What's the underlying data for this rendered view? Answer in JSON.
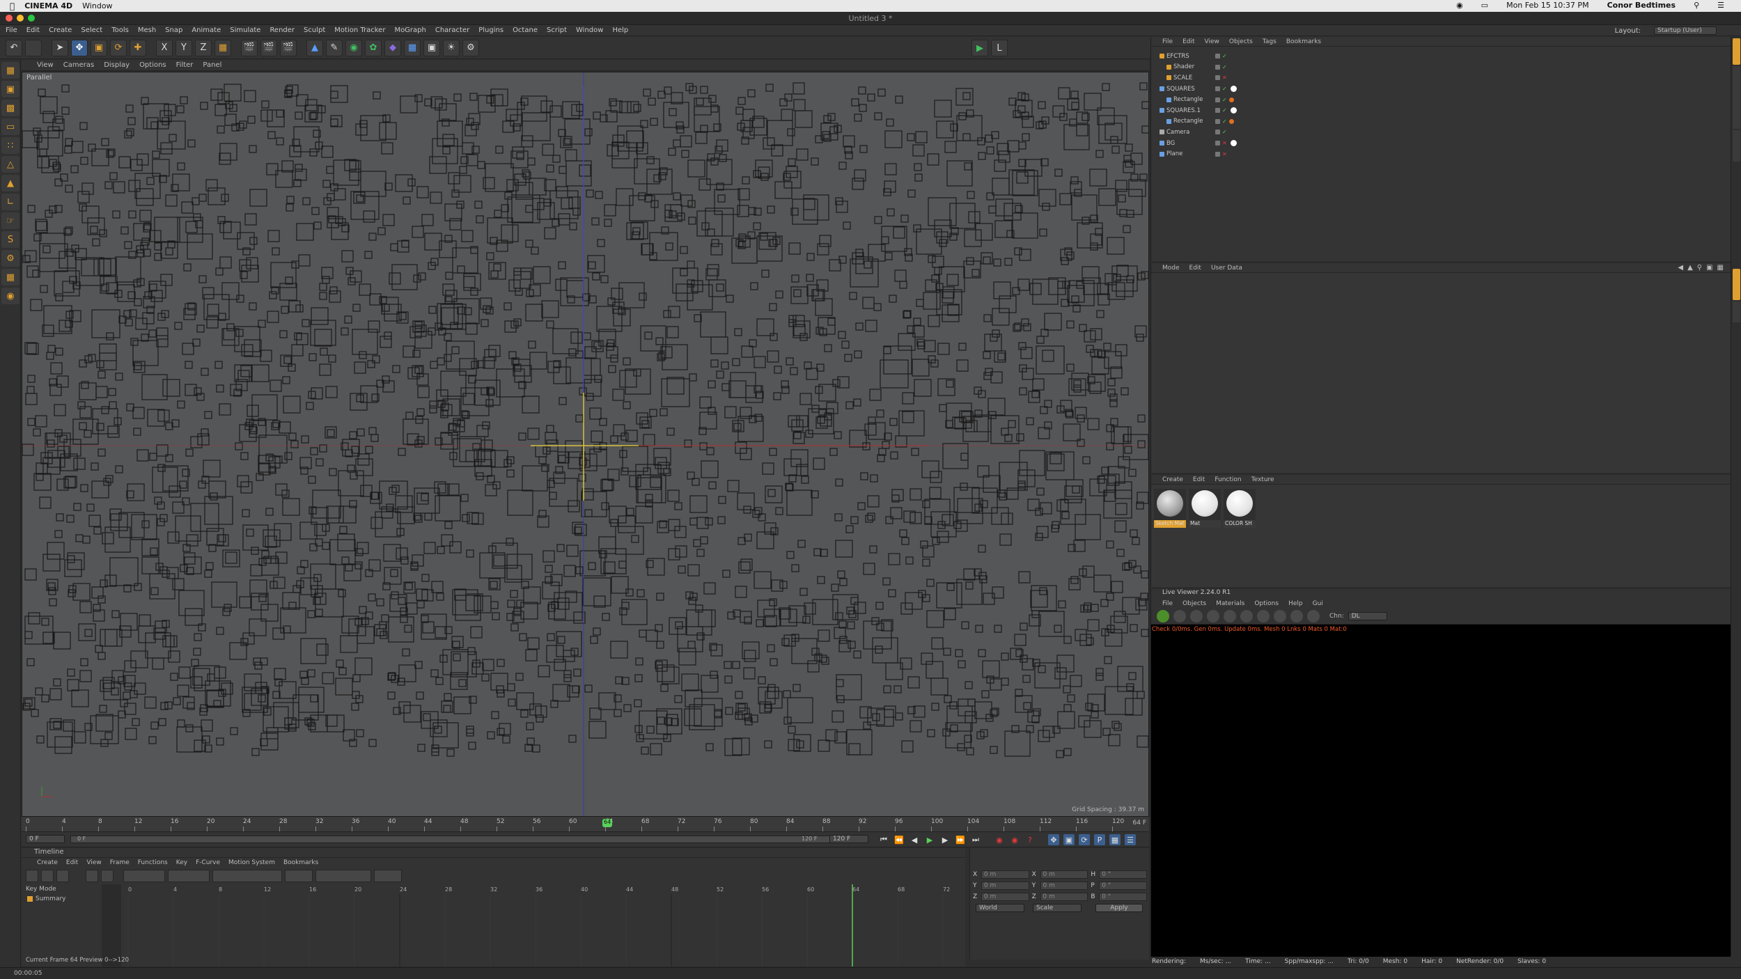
{
  "mac_menu": {
    "app": "CINEMA 4D",
    "window": "Window",
    "datetime": "Mon Feb 15  10:37 PM",
    "user": "Conor Bedtimes"
  },
  "window_title": "Untitled 3 *",
  "app_menu": [
    "File",
    "Edit",
    "Create",
    "Select",
    "Tools",
    "Mesh",
    "Snap",
    "Animate",
    "Simulate",
    "Render",
    "Sculpt",
    "Motion Tracker",
    "MoGraph",
    "Character",
    "Plugins",
    "Octane",
    "Script",
    "Window",
    "Help"
  ],
  "layout": {
    "label": "Layout:",
    "value": "Startup (User)"
  },
  "viewport": {
    "menu": [
      "View",
      "Cameras",
      "Display",
      "Options",
      "Filter",
      "Panel"
    ],
    "projection": "Parallel",
    "grid_spacing": "Grid Spacing : 39.37 m"
  },
  "timeline_ruler": {
    "ticks": [
      "0",
      "4",
      "8",
      "12",
      "16",
      "20",
      "24",
      "28",
      "32",
      "36",
      "40",
      "44",
      "48",
      "52",
      "56",
      "60",
      "64",
      "68",
      "72",
      "76",
      "80",
      "84",
      "88",
      "92",
      "96",
      "100",
      "104",
      "108",
      "112",
      "116",
      "120"
    ],
    "current_marker": "64",
    "end_field": "64 F"
  },
  "frame_controls": {
    "start": "0 F",
    "min_field": "0 F",
    "max_field": "120 F",
    "end": "120 F"
  },
  "timeline": {
    "title": "Timeline",
    "menu": [
      "Create",
      "Edit",
      "View",
      "Frame",
      "Functions",
      "Key",
      "F-Curve",
      "Motion System",
      "Bookmarks"
    ],
    "key_mode": "Key Mode",
    "summary": "Summary",
    "ruler": [
      "0",
      "4",
      "8",
      "12",
      "16",
      "20",
      "24",
      "28",
      "32",
      "36",
      "40",
      "44",
      "48",
      "52",
      "56",
      "60",
      "64",
      "68",
      "72"
    ],
    "current_frame_text": "Current Frame  64  Preview  0-->120"
  },
  "coords": {
    "rows": [
      [
        "X",
        "0 m",
        "X",
        "0 m",
        "H",
        "0 °"
      ],
      [
        "Y",
        "0 m",
        "Y",
        "0 m",
        "P",
        "0 °"
      ],
      [
        "Z",
        "0 m",
        "Z",
        "0 m",
        "B",
        "0 °"
      ]
    ],
    "mode1": "World",
    "mode2": "Scale",
    "apply": "Apply"
  },
  "object_manager": {
    "menu": [
      "File",
      "Edit",
      "View",
      "Objects",
      "Tags",
      "Bookmarks"
    ],
    "objects": [
      {
        "name": "EFCTRS",
        "indent": 0
      },
      {
        "name": "Shader",
        "indent": 1
      },
      {
        "name": "SCALE",
        "indent": 1
      },
      {
        "name": "SQUARES",
        "indent": 0
      },
      {
        "name": "Rectangle",
        "indent": 1
      },
      {
        "name": "SQUARES.1",
        "indent": 0
      },
      {
        "name": "Rectangle",
        "indent": 1
      },
      {
        "name": "Camera",
        "indent": 0
      },
      {
        "name": "BG",
        "indent": 0
      },
      {
        "name": "Plane",
        "indent": 0
      }
    ]
  },
  "attribute_manager": {
    "menu": [
      "Mode",
      "Edit",
      "User Data"
    ]
  },
  "material_manager": {
    "menu": [
      "Create",
      "Edit",
      "Function",
      "Texture"
    ],
    "materials": [
      "Sketch Mat",
      "Mat",
      "COLOR SH"
    ]
  },
  "live_viewer": {
    "title": "Live Viewer 2.24.0 R1",
    "menu": [
      "File",
      "Objects",
      "Materials",
      "Options",
      "Help",
      "Gui"
    ],
    "channel_label": "Chn:",
    "channel_value": "DL",
    "status": "Check 0/0ms. Gen 0ms. Update 0ms. Mesh 0 Lnks 0 Mats 0 Mat:0",
    "status_color": "#f05a28"
  },
  "render_status": {
    "rendering": "Rendering:",
    "ms": "Ms/sec: ...",
    "time": "Time: ...",
    "spp": "Spp/maxspp: ...",
    "tri": "Tri: 0/0",
    "mesh": "Mesh: 0",
    "hair": "Hair: 0",
    "netrender": "NetRender: 0/0",
    "slaves": "Slaves: 0"
  },
  "statusbar": {
    "time": "00:00:05"
  },
  "colors": {
    "viewport_bg": "#555658",
    "square_stroke": "#1b1b1b",
    "x_axis": "#b03030",
    "y_axis": "#3a3aa8",
    "accent": "#e0a030"
  }
}
